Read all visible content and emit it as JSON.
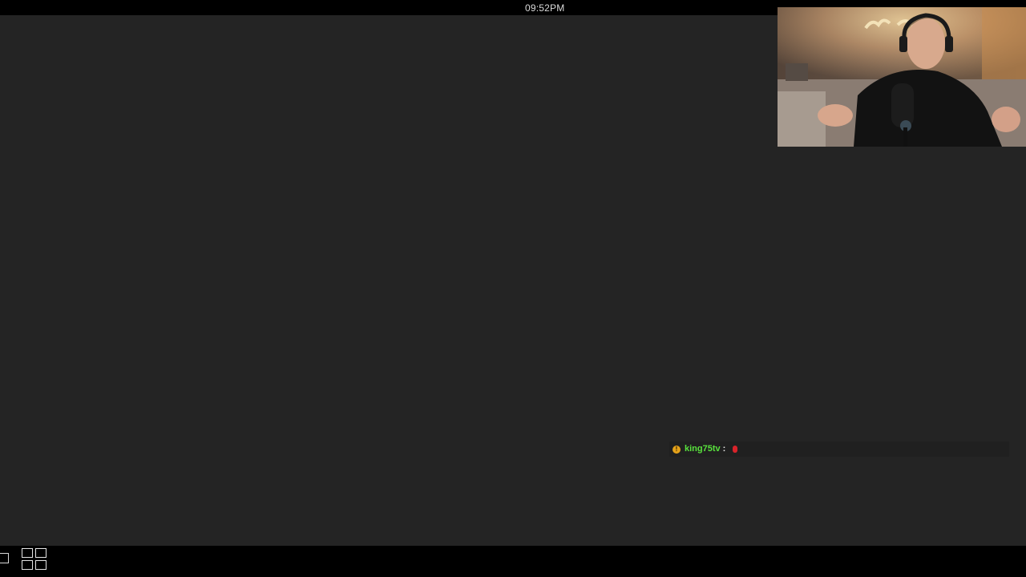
{
  "top_bar": {
    "clock": "09:52PM"
  },
  "webcam": {
    "icon": "webcam-feed-icon"
  },
  "chat": {
    "messages": [
      {
        "badge_icon": "bits-badge-icon",
        "badge_color": "#e5a21a",
        "username": "king75tv",
        "username_color": "#59e23d",
        "separator": ":",
        "emote_icon": "red-emote-icon"
      }
    ]
  },
  "taskbar": {
    "icons": [
      "window-icon",
      "grid-view-icon"
    ]
  }
}
